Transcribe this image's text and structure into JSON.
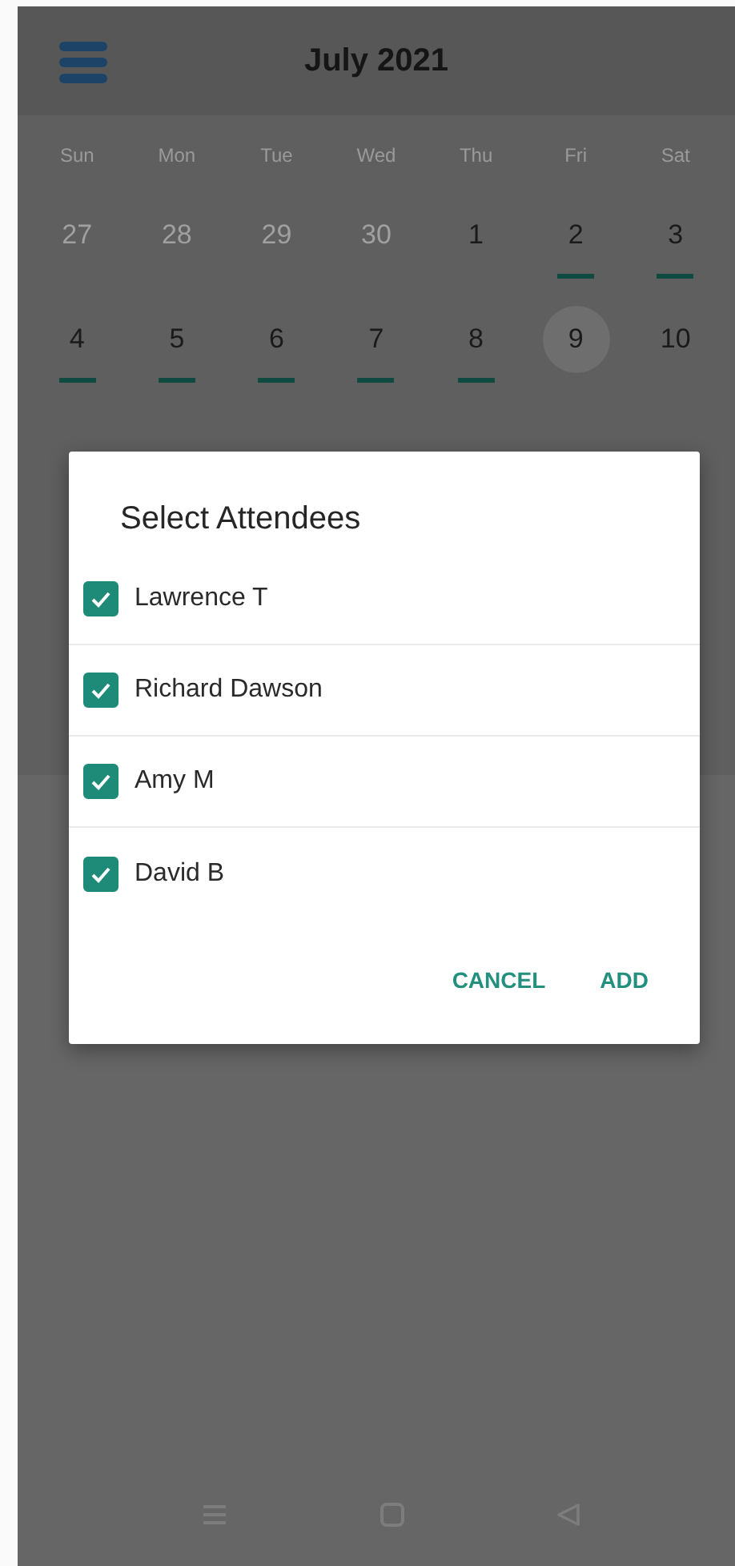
{
  "header": {
    "title": "July 2021"
  },
  "calendar": {
    "weekdays": [
      "Sun",
      "Mon",
      "Tue",
      "Wed",
      "Thu",
      "Fri",
      "Sat"
    ],
    "weeks": [
      [
        {
          "label": "27",
          "in_month": false,
          "has_event": false,
          "selected": false
        },
        {
          "label": "28",
          "in_month": false,
          "has_event": false,
          "selected": false
        },
        {
          "label": "29",
          "in_month": false,
          "has_event": false,
          "selected": false
        },
        {
          "label": "30",
          "in_month": false,
          "has_event": false,
          "selected": false
        },
        {
          "label": "1",
          "in_month": true,
          "has_event": false,
          "selected": false
        },
        {
          "label": "2",
          "in_month": true,
          "has_event": true,
          "selected": false
        },
        {
          "label": "3",
          "in_month": true,
          "has_event": true,
          "selected": false
        }
      ],
      [
        {
          "label": "4",
          "in_month": true,
          "has_event": true,
          "selected": false
        },
        {
          "label": "5",
          "in_month": true,
          "has_event": true,
          "selected": false
        },
        {
          "label": "6",
          "in_month": true,
          "has_event": true,
          "selected": false
        },
        {
          "label": "7",
          "in_month": true,
          "has_event": true,
          "selected": false
        },
        {
          "label": "8",
          "in_month": true,
          "has_event": true,
          "selected": false
        },
        {
          "label": "9",
          "in_month": true,
          "has_event": false,
          "selected": true
        },
        {
          "label": "10",
          "in_month": true,
          "has_event": false,
          "selected": false
        }
      ]
    ]
  },
  "dialog": {
    "title": "Select Attendees",
    "attendees": [
      {
        "name": "Lawrence T",
        "checked": true
      },
      {
        "name": "Richard Dawson",
        "checked": true
      },
      {
        "name": "Amy M",
        "checked": true
      },
      {
        "name": "David B",
        "checked": true
      }
    ],
    "buttons": [
      {
        "label": "CANCEL"
      },
      {
        "label": "ADD"
      }
    ]
  }
}
